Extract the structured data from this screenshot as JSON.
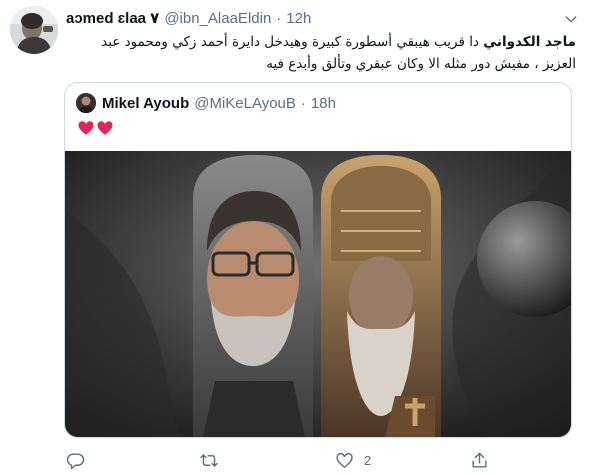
{
  "tweet": {
    "display_name": "aɔmed ɛlaa ٧",
    "handle": "@ibn_AlaaEldin",
    "separator": "·",
    "time": "12h",
    "text_bold": "ماجد الكدواني",
    "text_rest": " دا قريب هيبقي أسطورة كبيرة وهيدخل دايرة أحمد زكي ومحمود عبد العزيز ، مفيش دور مثله الا وكان عبقري وتألق وأبدع فيه"
  },
  "quoted_tweet": {
    "display_name": "Mikel Ayoub",
    "handle": "@MiKeLAyouB",
    "separator": "·",
    "time": "18h",
    "text": "❤️❤️",
    "media_icon": "poster-image"
  },
  "actions": {
    "reply_icon": "reply-icon",
    "retweet_icon": "retweet-icon",
    "like_icon": "like-icon",
    "like_count": "2",
    "share_icon": "share-icon"
  },
  "colors": {
    "text": "#0f1419",
    "secondary": "#5b7083",
    "border": "#cfd9de",
    "heart": "#e0245e"
  }
}
